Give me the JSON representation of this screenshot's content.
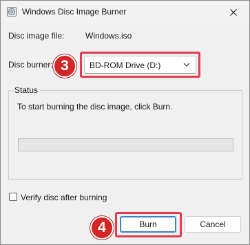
{
  "window": {
    "title": "Windows Disc Image Burner"
  },
  "icons": {
    "app": "disc-burner-icon",
    "close": "close-icon",
    "chevron": "chevron-down-icon"
  },
  "form": {
    "disc_image_label": "Disc image file:",
    "disc_image_value": "Windows.iso",
    "burner_label": "Disc burner:",
    "burner_selected": "BD-ROM Drive (D:)"
  },
  "status": {
    "legend": "Status",
    "message": "To start burning the disc image, click Burn.",
    "progress": 0
  },
  "verify": {
    "label": "Verify disc after burning",
    "checked": false
  },
  "buttons": {
    "burn": "Burn",
    "cancel": "Cancel"
  },
  "annotations": {
    "step3": "3",
    "step4": "4"
  },
  "colors": {
    "annotation_red": "#d42626",
    "highlight_border": "#e23a4e",
    "focus_blue": "#3b82c8"
  }
}
